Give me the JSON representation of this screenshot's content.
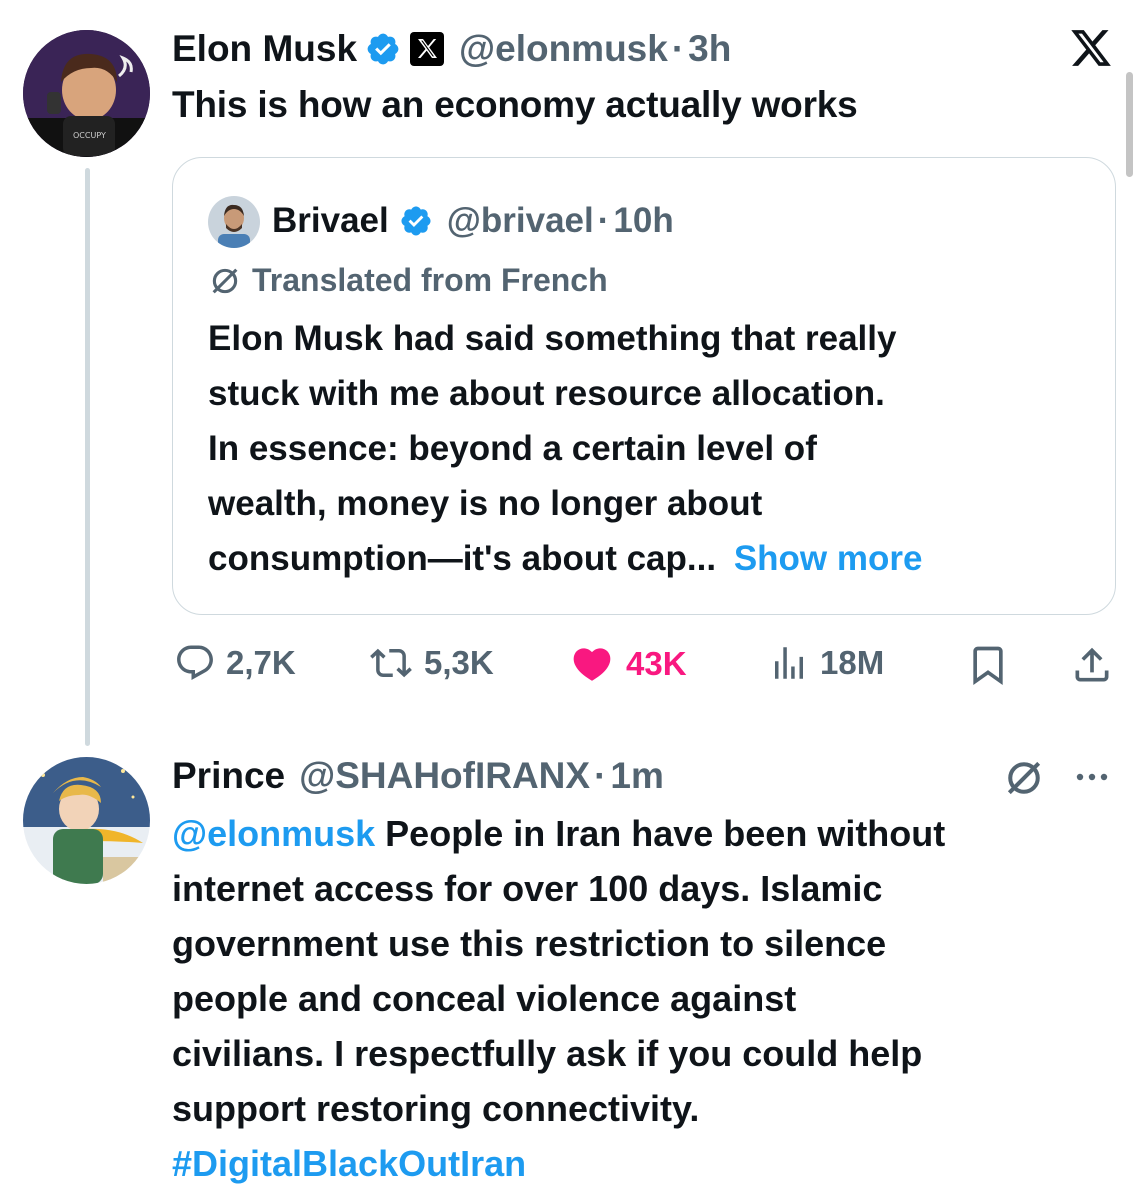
{
  "tweet": {
    "author": {
      "name": "Elon Musk",
      "handle": "@elonmusk",
      "time": "3h"
    },
    "text": "This is how an economy actually works",
    "quote": {
      "author": {
        "name": "Brivael",
        "handle": "@brivael",
        "time": "10h"
      },
      "translated_label": "Translated from French",
      "lines": [
        "Elon Musk had said something that really",
        "stuck with me about resource allocation.",
        "In essence: beyond a certain level of",
        "wealth, money is no longer about",
        "consumption—it's about cap..."
      ],
      "show_more": "Show more"
    },
    "actions": {
      "replies": "2,7K",
      "retweets": "5,3K",
      "likes": "43K",
      "views": "18M"
    }
  },
  "reply": {
    "author": {
      "name": "Prince",
      "handle": "@SHAHofIRANX",
      "time": "1m"
    },
    "mention": "@elonmusk",
    "first_line": "People in Iran have been without",
    "lines": [
      "internet access for over 100 days. Islamic",
      "government use this restriction to silence",
      "people and conceal violence against",
      "civilians. I respectfully ask if you could help",
      "support restoring connectivity."
    ],
    "hashtag": "#DigitalBlackOutIran"
  },
  "colors": {
    "accent": "#1d9bf0",
    "like": "#f91880",
    "muted": "#536471",
    "text": "#0f1419"
  },
  "icons": [
    "x-logo-icon",
    "verified-badge-icon",
    "x-affiliate-badge-icon",
    "translate-icon",
    "reply-icon",
    "retweet-icon",
    "heart-icon",
    "views-icon",
    "bookmark-icon",
    "share-icon",
    "more-icon"
  ]
}
